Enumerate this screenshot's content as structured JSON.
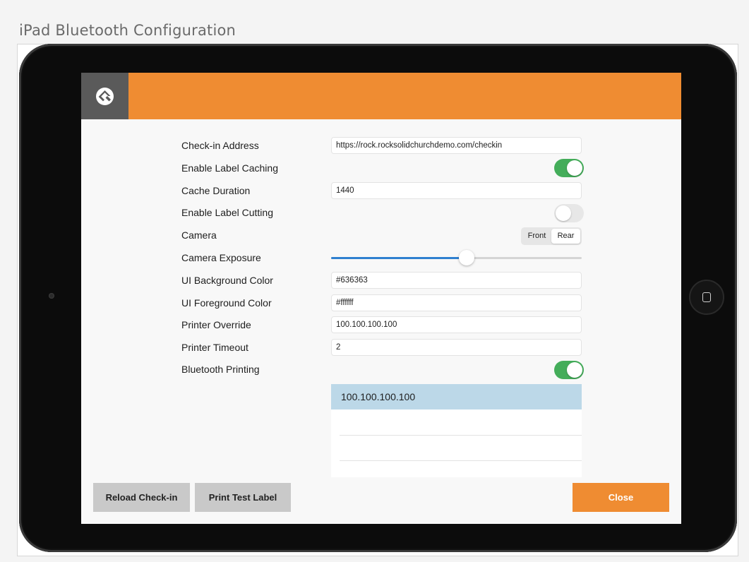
{
  "caption": "iPad Bluetooth Configuration",
  "settings": {
    "checkin_address": {
      "label": "Check-in Address",
      "value": "https://rock.rocksolidchurchdemo.com/checkin"
    },
    "label_caching": {
      "label": "Enable Label Caching",
      "on": true
    },
    "cache_duration": {
      "label": "Cache Duration",
      "value": "1440"
    },
    "label_cutting": {
      "label": "Enable Label Cutting",
      "on": false
    },
    "camera": {
      "label": "Camera",
      "options": [
        "Front",
        "Rear"
      ],
      "selected": "Rear"
    },
    "camera_exposure": {
      "label": "Camera Exposure",
      "level_percent": 54
    },
    "ui_background": {
      "label": "UI Background Color",
      "value": "#636363"
    },
    "ui_foreground": {
      "label": "UI Foreground Color",
      "value": "#ffffff"
    },
    "printer_override": {
      "label": "Printer Override",
      "value": "100.100.100.100"
    },
    "printer_timeout": {
      "label": "Printer Timeout",
      "value": "2"
    },
    "bluetooth_printing": {
      "label": "Bluetooth Printing",
      "on": true
    }
  },
  "printer_list": {
    "items": [
      "100.100.100.100"
    ],
    "selected_index": 0
  },
  "buttons": {
    "reload": "Reload Check-in",
    "print_test": "Print Test Label",
    "close": "Close"
  },
  "colors": {
    "accent": "#ef8c32",
    "toggle_on": "#44ad5a",
    "selected_row": "#bcd8e8",
    "slider": "#2f80d0"
  }
}
